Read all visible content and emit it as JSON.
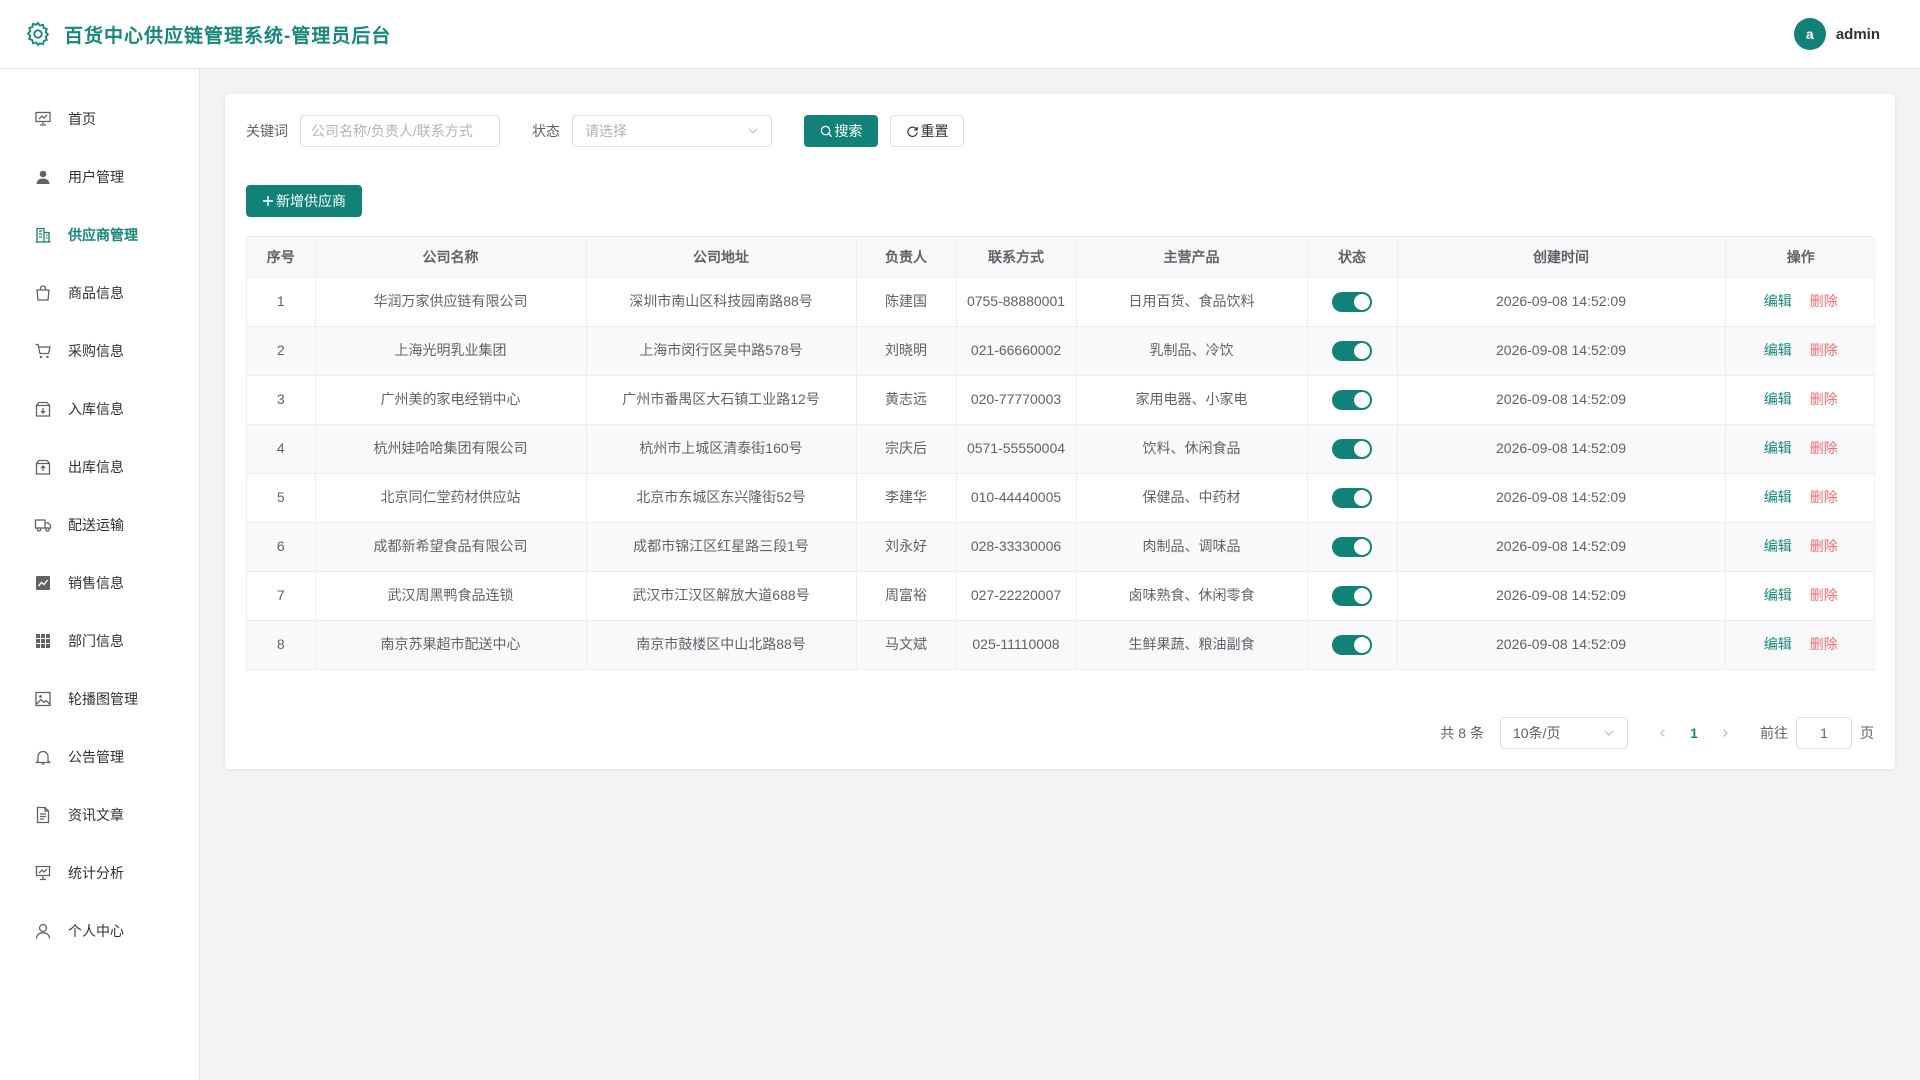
{
  "header": {
    "title": "百货中心供应链管理系统-管理员后台",
    "avatar_letter": "a",
    "username": "admin"
  },
  "sidebar": {
    "items": [
      {
        "label": "首页",
        "icon": "dashboard-icon"
      },
      {
        "label": "用户管理",
        "icon": "user-icon"
      },
      {
        "label": "供应商管理",
        "icon": "building-icon"
      },
      {
        "label": "商品信息",
        "icon": "shopping-bag-icon"
      },
      {
        "label": "采购信息",
        "icon": "cart-icon"
      },
      {
        "label": "入库信息",
        "icon": "box-in-icon"
      },
      {
        "label": "出库信息",
        "icon": "box-out-icon"
      },
      {
        "label": "配送运输",
        "icon": "truck-icon"
      },
      {
        "label": "销售信息",
        "icon": "chart-icon"
      },
      {
        "label": "部门信息",
        "icon": "grid-icon"
      },
      {
        "label": "轮播图管理",
        "icon": "image-icon"
      },
      {
        "label": "公告管理",
        "icon": "bell-icon"
      },
      {
        "label": "资讯文章",
        "icon": "document-icon"
      },
      {
        "label": "统计分析",
        "icon": "presentation-icon"
      },
      {
        "label": "个人中心",
        "icon": "person-icon"
      }
    ],
    "active_index": 2
  },
  "filter": {
    "keyword_label": "关键词",
    "keyword_placeholder": "公司名称/负责人/联系方式",
    "keyword_value": "",
    "status_label": "状态",
    "status_placeholder": "请选择",
    "search_label": "搜索",
    "reset_label": "重置"
  },
  "add_button_label": "新增供应商",
  "table": {
    "columns": [
      "序号",
      "公司名称",
      "公司地址",
      "负责人",
      "联系方式",
      "主营产品",
      "状态",
      "创建时间",
      "操作"
    ],
    "edit_label": "编辑",
    "delete_label": "删除",
    "rows": [
      {
        "no": "1",
        "company": "华润万家供应链有限公司",
        "address": "深圳市南山区科技园南路88号",
        "manager": "陈建国",
        "phone": "0755-88880001",
        "products": "日用百货、食品饮料",
        "enabled": true,
        "created": "2026-09-08 14:52:09"
      },
      {
        "no": "2",
        "company": "上海光明乳业集团",
        "address": "上海市闵行区吴中路578号",
        "manager": "刘晓明",
        "phone": "021-66660002",
        "products": "乳制品、冷饮",
        "enabled": true,
        "created": "2026-09-08 14:52:09"
      },
      {
        "no": "3",
        "company": "广州美的家电经销中心",
        "address": "广州市番禺区大石镇工业路12号",
        "manager": "黄志远",
        "phone": "020-77770003",
        "products": "家用电器、小家电",
        "enabled": true,
        "created": "2026-09-08 14:52:09"
      },
      {
        "no": "4",
        "company": "杭州娃哈哈集团有限公司",
        "address": "杭州市上城区清泰街160号",
        "manager": "宗庆后",
        "phone": "0571-55550004",
        "products": "饮料、休闲食品",
        "enabled": true,
        "created": "2026-09-08 14:52:09"
      },
      {
        "no": "5",
        "company": "北京同仁堂药材供应站",
        "address": "北京市东城区东兴隆街52号",
        "manager": "李建华",
        "phone": "010-44440005",
        "products": "保健品、中药材",
        "enabled": true,
        "created": "2026-09-08 14:52:09"
      },
      {
        "no": "6",
        "company": "成都新希望食品有限公司",
        "address": "成都市锦江区红星路三段1号",
        "manager": "刘永好",
        "phone": "028-33330006",
        "products": "肉制品、调味品",
        "enabled": true,
        "created": "2026-09-08 14:52:09"
      },
      {
        "no": "7",
        "company": "武汉周黑鸭食品连锁",
        "address": "武汉市江汉区解放大道688号",
        "manager": "周富裕",
        "phone": "027-22220007",
        "products": "卤味熟食、休闲零食",
        "enabled": true,
        "created": "2026-09-08 14:52:09"
      },
      {
        "no": "8",
        "company": "南京苏果超市配送中心",
        "address": "南京市鼓楼区中山北路88号",
        "manager": "马文斌",
        "phone": "025-11110008",
        "products": "生鲜果蔬、粮油副食",
        "enabled": true,
        "created": "2026-09-08 14:52:09"
      }
    ]
  },
  "pagination": {
    "total_text": "共 8 条",
    "page_size": "10条/页",
    "current_page": "1",
    "goto_label": "前往",
    "goto_value": "1",
    "page_suffix": "页"
  },
  "colors": {
    "primary": "#128177",
    "danger": "#f56c6c"
  }
}
